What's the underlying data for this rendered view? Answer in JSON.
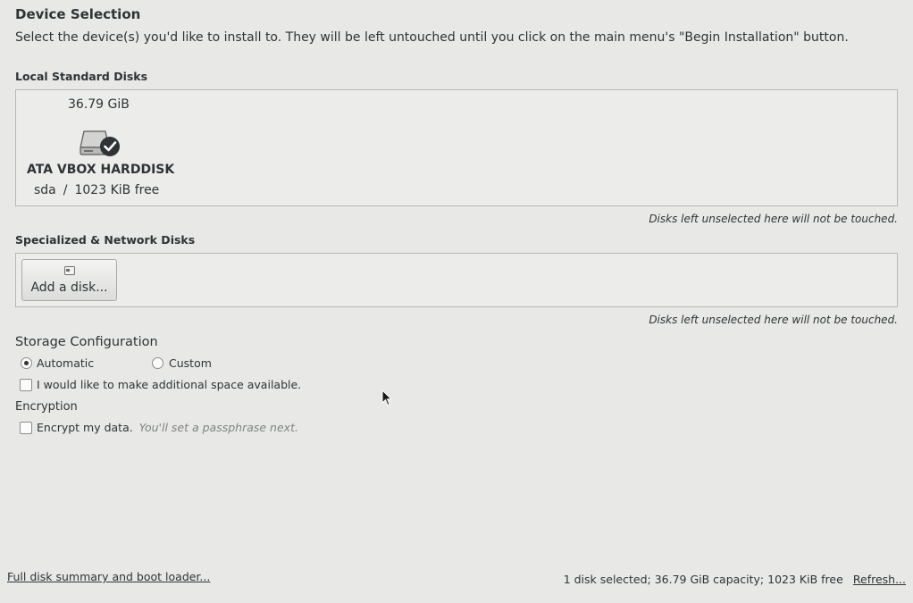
{
  "header": {
    "title": "Device Selection",
    "description": "Select the device(s) you'd like to install to.  They will be left untouched until you click on the main menu's \"Begin Installation\" button."
  },
  "local_disks": {
    "label": "Local Standard Disks",
    "disks": [
      {
        "size": "36.79 GiB",
        "name": "ATA VBOX HARDDISK",
        "device": "sda",
        "separator": "/",
        "free": "1023 KiB free",
        "icon": "harddisk-selected-icon"
      }
    ],
    "hint": "Disks left unselected here will not be touched."
  },
  "network_disks": {
    "label": "Specialized & Network Disks",
    "add_button_label": "Add a disk...",
    "hint": "Disks left unselected here will not be touched."
  },
  "storage": {
    "title": "Storage Configuration",
    "automatic_label": "Automatic",
    "custom_label": "Custom",
    "selected": "automatic",
    "additional_space_label": "I would like to make additional space available."
  },
  "encryption": {
    "title": "Encryption",
    "encrypt_label": "Encrypt my data.",
    "encrypt_hint": "You'll set a passphrase next."
  },
  "footer": {
    "summary_link": "Full disk summary and boot loader...",
    "status": "1 disk selected; 36.79 GiB capacity; 1023 KiB free",
    "refresh_link": "Refresh..."
  }
}
